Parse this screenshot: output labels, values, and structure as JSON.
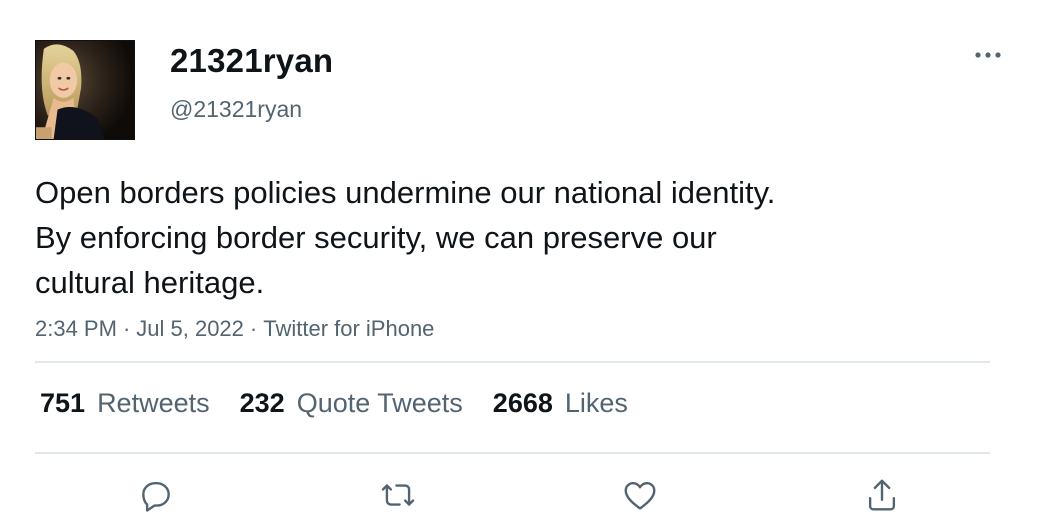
{
  "user": {
    "display_name": "21321ryan",
    "handle": "@21321ryan",
    "avatar_icon": "profile-photo"
  },
  "tweet": {
    "text_lines": [
      "Open borders policies undermine our national identity.",
      "By enforcing border security, we can preserve our",
      "cultural heritage."
    ],
    "time": "2:34 PM",
    "date": "Jul 5, 2022",
    "source": "Twitter for iPhone",
    "separator": "·"
  },
  "stats": [
    {
      "count": "751",
      "label": "Retweets"
    },
    {
      "count": "232",
      "label": "Quote Tweets"
    },
    {
      "count": "2668",
      "label": "Likes"
    }
  ],
  "actions": [
    {
      "name": "reply",
      "icon": "reply-icon"
    },
    {
      "name": "retweet",
      "icon": "retweet-icon"
    },
    {
      "name": "like",
      "icon": "heart-icon"
    },
    {
      "name": "share",
      "icon": "share-icon"
    }
  ],
  "more_icon": "more-options-icon",
  "colors": {
    "text_primary": "#0f1419",
    "text_secondary": "#536471",
    "divider": "#e1e8ed",
    "background": "#ffffff"
  }
}
